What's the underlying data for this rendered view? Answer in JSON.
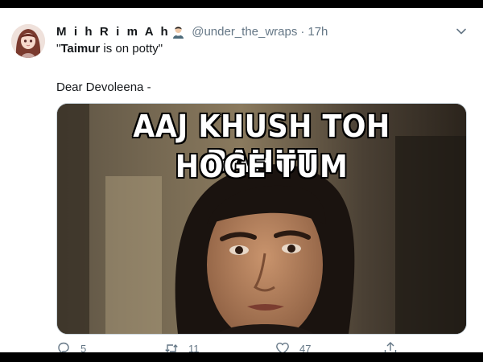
{
  "tweet": {
    "display_name": "M i h R i m A h",
    "handle": "@under_the_wraps",
    "separator": "·",
    "time": "17h",
    "text_line1_prefix": "\"",
    "text_line1_bold": "Taimur",
    "text_line1_rest": " is on potty\"",
    "text_line2": "Dear Devoleena -"
  },
  "media": {
    "caption_line1": "AAJ KHUSH TOH BAHUT",
    "caption_line2": "HOGE TUM"
  },
  "actions": {
    "reply_count": "5",
    "retweet_count": "11",
    "like_count": "47"
  },
  "icons": {
    "avatar": "anime-girl-avatar",
    "emoji": "person-emoji-icon",
    "menu": "chevron-down-icon",
    "reply": "reply-icon",
    "retweet": "retweet-icon",
    "like": "heart-icon",
    "share": "share-icon"
  },
  "colors": {
    "text": "#14171a",
    "muted": "#657786",
    "frame": "#000000"
  }
}
